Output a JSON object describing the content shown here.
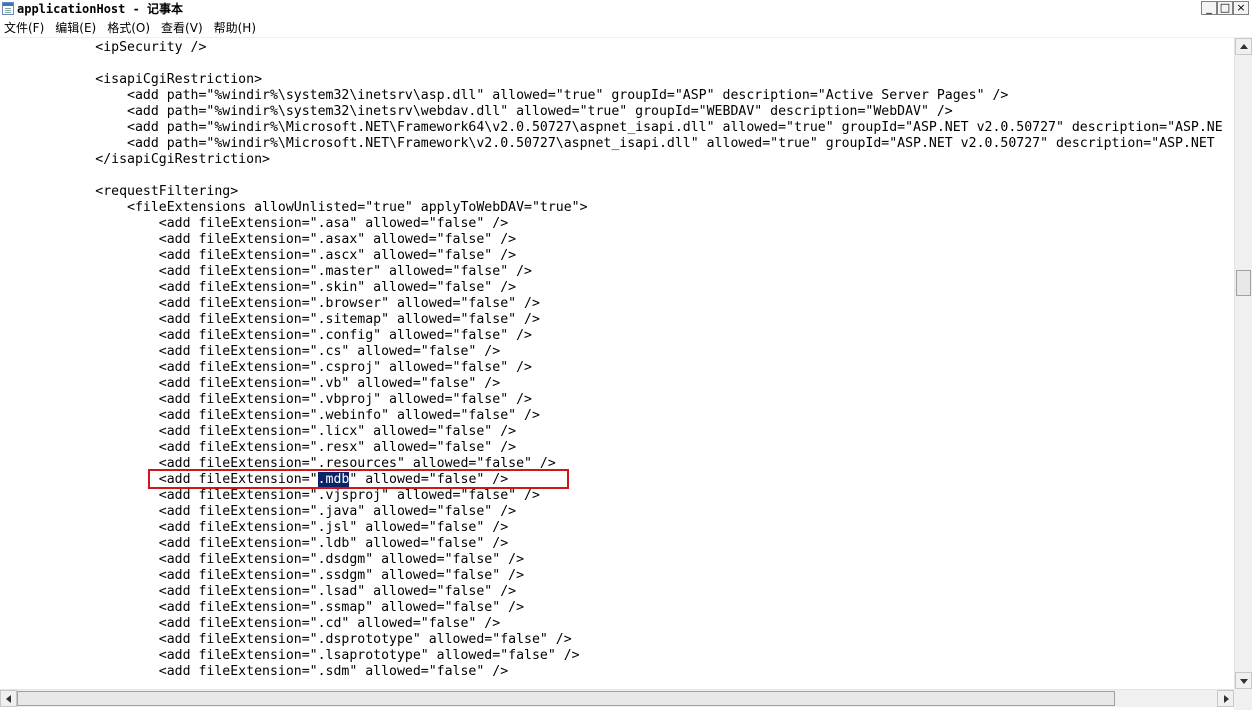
{
  "window": {
    "title": "applicationHost - 记事本",
    "controls": {
      "minimize": "_",
      "maximize": "□",
      "close": "×"
    }
  },
  "menu": [
    "文件(F)",
    "编辑(E)",
    "格式(O)",
    "查看(V)",
    "帮助(H)"
  ],
  "editor": {
    "lines": [
      "            <ipSecurity />",
      "",
      "            <isapiCgiRestriction>",
      "                <add path=\"%windir%\\system32\\inetsrv\\asp.dll\" allowed=\"true\" groupId=\"ASP\" description=\"Active Server Pages\" />",
      "                <add path=\"%windir%\\system32\\inetsrv\\webdav.dll\" allowed=\"true\" groupId=\"WEBDAV\" description=\"WebDAV\" />",
      "                <add path=\"%windir%\\Microsoft.NET\\Framework64\\v2.0.50727\\aspnet_isapi.dll\" allowed=\"true\" groupId=\"ASP.NET v2.0.50727\" description=\"ASP.NE",
      "                <add path=\"%windir%\\Microsoft.NET\\Framework\\v2.0.50727\\aspnet_isapi.dll\" allowed=\"true\" groupId=\"ASP.NET v2.0.50727\" description=\"ASP.NET",
      "            </isapiCgiRestriction>",
      "",
      "            <requestFiltering>",
      "                <fileExtensions allowUnlisted=\"true\" applyToWebDAV=\"true\">",
      "                    <add fileExtension=\".asa\" allowed=\"false\" />",
      "                    <add fileExtension=\".asax\" allowed=\"false\" />",
      "                    <add fileExtension=\".ascx\" allowed=\"false\" />",
      "                    <add fileExtension=\".master\" allowed=\"false\" />",
      "                    <add fileExtension=\".skin\" allowed=\"false\" />",
      "                    <add fileExtension=\".browser\" allowed=\"false\" />",
      "                    <add fileExtension=\".sitemap\" allowed=\"false\" />",
      "                    <add fileExtension=\".config\" allowed=\"false\" />",
      "                    <add fileExtension=\".cs\" allowed=\"false\" />",
      "                    <add fileExtension=\".csproj\" allowed=\"false\" />",
      "                    <add fileExtension=\".vb\" allowed=\"false\" />",
      "                    <add fileExtension=\".vbproj\" allowed=\"false\" />",
      "                    <add fileExtension=\".webinfo\" allowed=\"false\" />",
      "                    <add fileExtension=\".licx\" allowed=\"false\" />",
      "                    <add fileExtension=\".resx\" allowed=\"false\" />",
      "                    <add fileExtension=\".resources\" allowed=\"false\" />",
      "                    <add fileExtension=\".mdb\" allowed=\"false\" />",
      "                    <add fileExtension=\".vjsproj\" allowed=\"false\" />",
      "                    <add fileExtension=\".java\" allowed=\"false\" />",
      "                    <add fileExtension=\".jsl\" allowed=\"false\" />",
      "                    <add fileExtension=\".ldb\" allowed=\"false\" />",
      "                    <add fileExtension=\".dsdgm\" allowed=\"false\" />",
      "                    <add fileExtension=\".ssdgm\" allowed=\"false\" />",
      "                    <add fileExtension=\".lsad\" allowed=\"false\" />",
      "                    <add fileExtension=\".ssmap\" allowed=\"false\" />",
      "                    <add fileExtension=\".cd\" allowed=\"false\" />",
      "                    <add fileExtension=\".dsprototype\" allowed=\"false\" />",
      "                    <add fileExtension=\".lsaprototype\" allowed=\"false\" />",
      "                    <add fileExtension=\".sdm\" allowed=\"false\" />"
    ],
    "selection": {
      "line_index": 27,
      "text": "mdb"
    },
    "highlight_box_color": "#d0151b",
    "selection_color": "#0a246a"
  },
  "scrollbars": {
    "vertical_position_fraction": 0.37,
    "horizontal_position_fraction": 0.0
  }
}
